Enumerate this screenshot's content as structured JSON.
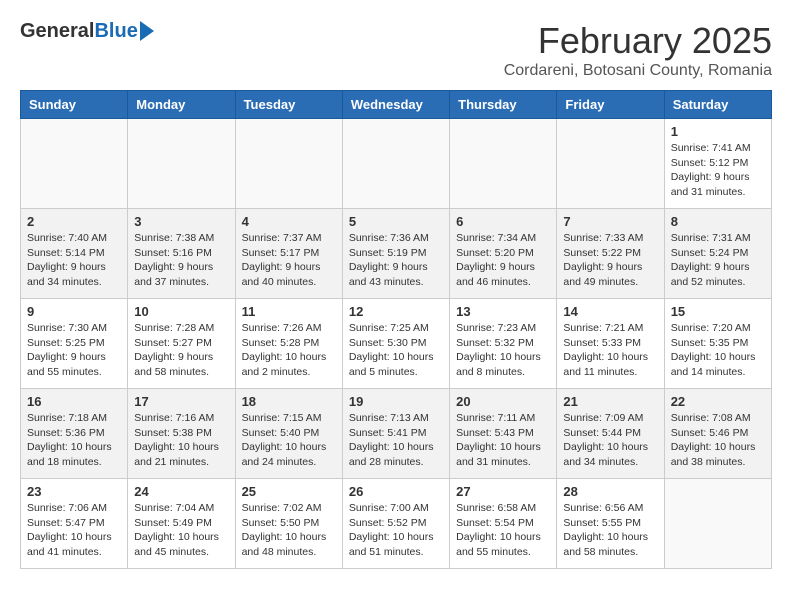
{
  "header": {
    "logo_general": "General",
    "logo_blue": "Blue",
    "month_title": "February 2025",
    "location": "Cordareni, Botosani County, Romania"
  },
  "weekdays": [
    "Sunday",
    "Monday",
    "Tuesday",
    "Wednesday",
    "Thursday",
    "Friday",
    "Saturday"
  ],
  "weeks": [
    {
      "days": [
        {
          "num": "",
          "info": ""
        },
        {
          "num": "",
          "info": ""
        },
        {
          "num": "",
          "info": ""
        },
        {
          "num": "",
          "info": ""
        },
        {
          "num": "",
          "info": ""
        },
        {
          "num": "",
          "info": ""
        },
        {
          "num": "1",
          "info": "Sunrise: 7:41 AM\nSunset: 5:12 PM\nDaylight: 9 hours\nand 31 minutes."
        }
      ]
    },
    {
      "days": [
        {
          "num": "2",
          "info": "Sunrise: 7:40 AM\nSunset: 5:14 PM\nDaylight: 9 hours\nand 34 minutes."
        },
        {
          "num": "3",
          "info": "Sunrise: 7:38 AM\nSunset: 5:16 PM\nDaylight: 9 hours\nand 37 minutes."
        },
        {
          "num": "4",
          "info": "Sunrise: 7:37 AM\nSunset: 5:17 PM\nDaylight: 9 hours\nand 40 minutes."
        },
        {
          "num": "5",
          "info": "Sunrise: 7:36 AM\nSunset: 5:19 PM\nDaylight: 9 hours\nand 43 minutes."
        },
        {
          "num": "6",
          "info": "Sunrise: 7:34 AM\nSunset: 5:20 PM\nDaylight: 9 hours\nand 46 minutes."
        },
        {
          "num": "7",
          "info": "Sunrise: 7:33 AM\nSunset: 5:22 PM\nDaylight: 9 hours\nand 49 minutes."
        },
        {
          "num": "8",
          "info": "Sunrise: 7:31 AM\nSunset: 5:24 PM\nDaylight: 9 hours\nand 52 minutes."
        }
      ]
    },
    {
      "days": [
        {
          "num": "9",
          "info": "Sunrise: 7:30 AM\nSunset: 5:25 PM\nDaylight: 9 hours\nand 55 minutes."
        },
        {
          "num": "10",
          "info": "Sunrise: 7:28 AM\nSunset: 5:27 PM\nDaylight: 9 hours\nand 58 minutes."
        },
        {
          "num": "11",
          "info": "Sunrise: 7:26 AM\nSunset: 5:28 PM\nDaylight: 10 hours\nand 2 minutes."
        },
        {
          "num": "12",
          "info": "Sunrise: 7:25 AM\nSunset: 5:30 PM\nDaylight: 10 hours\nand 5 minutes."
        },
        {
          "num": "13",
          "info": "Sunrise: 7:23 AM\nSunset: 5:32 PM\nDaylight: 10 hours\nand 8 minutes."
        },
        {
          "num": "14",
          "info": "Sunrise: 7:21 AM\nSunset: 5:33 PM\nDaylight: 10 hours\nand 11 minutes."
        },
        {
          "num": "15",
          "info": "Sunrise: 7:20 AM\nSunset: 5:35 PM\nDaylight: 10 hours\nand 14 minutes."
        }
      ]
    },
    {
      "days": [
        {
          "num": "16",
          "info": "Sunrise: 7:18 AM\nSunset: 5:36 PM\nDaylight: 10 hours\nand 18 minutes."
        },
        {
          "num": "17",
          "info": "Sunrise: 7:16 AM\nSunset: 5:38 PM\nDaylight: 10 hours\nand 21 minutes."
        },
        {
          "num": "18",
          "info": "Sunrise: 7:15 AM\nSunset: 5:40 PM\nDaylight: 10 hours\nand 24 minutes."
        },
        {
          "num": "19",
          "info": "Sunrise: 7:13 AM\nSunset: 5:41 PM\nDaylight: 10 hours\nand 28 minutes."
        },
        {
          "num": "20",
          "info": "Sunrise: 7:11 AM\nSunset: 5:43 PM\nDaylight: 10 hours\nand 31 minutes."
        },
        {
          "num": "21",
          "info": "Sunrise: 7:09 AM\nSunset: 5:44 PM\nDaylight: 10 hours\nand 34 minutes."
        },
        {
          "num": "22",
          "info": "Sunrise: 7:08 AM\nSunset: 5:46 PM\nDaylight: 10 hours\nand 38 minutes."
        }
      ]
    },
    {
      "days": [
        {
          "num": "23",
          "info": "Sunrise: 7:06 AM\nSunset: 5:47 PM\nDaylight: 10 hours\nand 41 minutes."
        },
        {
          "num": "24",
          "info": "Sunrise: 7:04 AM\nSunset: 5:49 PM\nDaylight: 10 hours\nand 45 minutes."
        },
        {
          "num": "25",
          "info": "Sunrise: 7:02 AM\nSunset: 5:50 PM\nDaylight: 10 hours\nand 48 minutes."
        },
        {
          "num": "26",
          "info": "Sunrise: 7:00 AM\nSunset: 5:52 PM\nDaylight: 10 hours\nand 51 minutes."
        },
        {
          "num": "27",
          "info": "Sunrise: 6:58 AM\nSunset: 5:54 PM\nDaylight: 10 hours\nand 55 minutes."
        },
        {
          "num": "28",
          "info": "Sunrise: 6:56 AM\nSunset: 5:55 PM\nDaylight: 10 hours\nand 58 minutes."
        },
        {
          "num": "",
          "info": ""
        }
      ]
    }
  ]
}
